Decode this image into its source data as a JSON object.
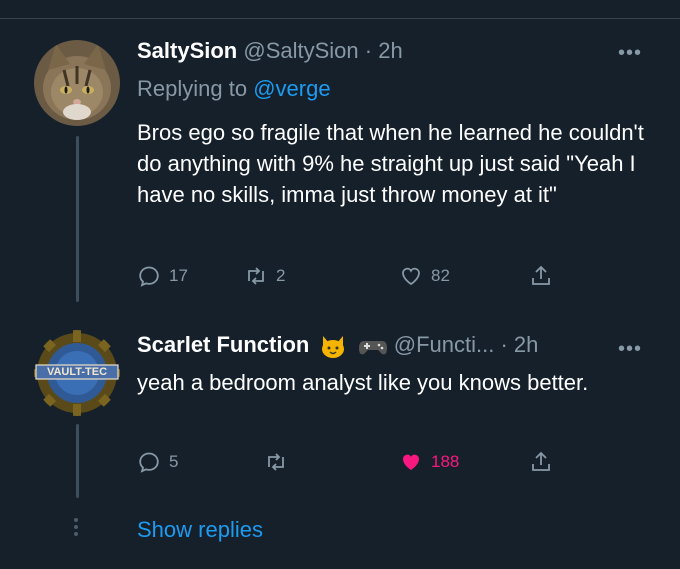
{
  "tweets": [
    {
      "name": "SaltySion",
      "handle": "@SaltySion",
      "dot": "·",
      "time": "2h",
      "replying_prefix": "Replying to ",
      "replying_to": "@verge",
      "text": "Bros ego so fragile that when he learned he couldn't do anything with 9% he straight up just said \"Yeah I have no skills, imma just throw money at it\"",
      "more": "•••",
      "actions": {
        "replies": "17",
        "retweets": "2",
        "likes": "82"
      }
    },
    {
      "name": "Scarlet Function",
      "handle": "@Functi...",
      "dot": "·",
      "time": "2h",
      "text": "yeah a bedroom analyst like you knows better.",
      "more": "•••",
      "avatar_text": "VAULT-TEC",
      "actions": {
        "replies": "5",
        "retweets": "",
        "likes": "188"
      }
    }
  ],
  "show_replies": "Show replies",
  "colors": {
    "background": "#15202b",
    "secondary": "#8899a6",
    "link": "#1d9bf0",
    "like": "#f91880"
  },
  "icons": [
    "reply-icon",
    "retweet-icon",
    "like-icon",
    "share-icon",
    "more-icon",
    "cat-emoji-icon",
    "gamepad-emoji-icon"
  ]
}
